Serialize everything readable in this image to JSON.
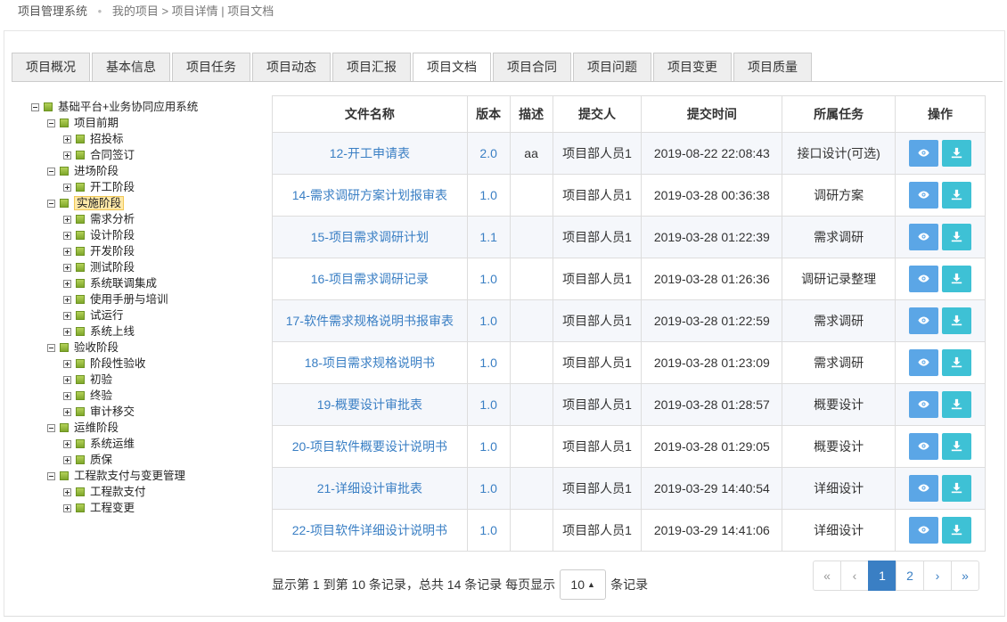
{
  "breadcrumb": {
    "system": "项目管理系统",
    "sep": "•",
    "path": "我的项目 > 项目详情 | 项目文档"
  },
  "tabs": [
    {
      "label": "项目概况",
      "active": false
    },
    {
      "label": "基本信息",
      "active": false
    },
    {
      "label": "项目任务",
      "active": false
    },
    {
      "label": "项目动态",
      "active": false
    },
    {
      "label": "项目汇报",
      "active": false
    },
    {
      "label": "项目文档",
      "active": true
    },
    {
      "label": "项目合同",
      "active": false
    },
    {
      "label": "项目问题",
      "active": false
    },
    {
      "label": "项目变更",
      "active": false
    },
    {
      "label": "项目质量",
      "active": false
    }
  ],
  "tree": [
    {
      "label": "基础平台+业务协同应用系统",
      "level": 0,
      "toggle": "minus"
    },
    {
      "label": "项目前期",
      "level": 1,
      "toggle": "minus"
    },
    {
      "label": "招投标",
      "level": 2,
      "toggle": "plus"
    },
    {
      "label": "合同签订",
      "level": 2,
      "toggle": "plus"
    },
    {
      "label": "进场阶段",
      "level": 1,
      "toggle": "minus"
    },
    {
      "label": "开工阶段",
      "level": 2,
      "toggle": "plus"
    },
    {
      "label": "实施阶段",
      "level": 1,
      "toggle": "minus",
      "selected": true
    },
    {
      "label": "需求分析",
      "level": 2,
      "toggle": "plus"
    },
    {
      "label": "设计阶段",
      "level": 2,
      "toggle": "plus"
    },
    {
      "label": "开发阶段",
      "level": 2,
      "toggle": "plus"
    },
    {
      "label": "测试阶段",
      "level": 2,
      "toggle": "plus"
    },
    {
      "label": "系统联调集成",
      "level": 2,
      "toggle": "plus"
    },
    {
      "label": "使用手册与培训",
      "level": 2,
      "toggle": "plus"
    },
    {
      "label": "试运行",
      "level": 2,
      "toggle": "plus"
    },
    {
      "label": "系统上线",
      "level": 2,
      "toggle": "plus"
    },
    {
      "label": "验收阶段",
      "level": 1,
      "toggle": "minus"
    },
    {
      "label": "阶段性验收",
      "level": 2,
      "toggle": "plus"
    },
    {
      "label": "初验",
      "level": 2,
      "toggle": "plus"
    },
    {
      "label": "终验",
      "level": 2,
      "toggle": "plus"
    },
    {
      "label": "审计移交",
      "level": 2,
      "toggle": "plus"
    },
    {
      "label": "运维阶段",
      "level": 1,
      "toggle": "minus"
    },
    {
      "label": "系统运维",
      "level": 2,
      "toggle": "plus"
    },
    {
      "label": "质保",
      "level": 2,
      "toggle": "plus"
    },
    {
      "label": "工程款支付与变更管理",
      "level": 1,
      "toggle": "minus"
    },
    {
      "label": "工程款支付",
      "level": 2,
      "toggle": "plus"
    },
    {
      "label": "工程变更",
      "level": 2,
      "toggle": "plus"
    }
  ],
  "table": {
    "headers": [
      "文件名称",
      "版本",
      "描述",
      "提交人",
      "提交时间",
      "所属任务",
      "操作"
    ],
    "rows": [
      {
        "name": "12-开工申请表",
        "version": "2.0",
        "desc": "aa",
        "submitter": "项目部人员1",
        "time": "2019-08-22 22:08:43",
        "task": "接口设计(可选)"
      },
      {
        "name": "14-需求调研方案计划报审表",
        "version": "1.0",
        "desc": "",
        "submitter": "项目部人员1",
        "time": "2019-03-28 00:36:38",
        "task": "调研方案"
      },
      {
        "name": "15-项目需求调研计划",
        "version": "1.1",
        "desc": "",
        "submitter": "项目部人员1",
        "time": "2019-03-28 01:22:39",
        "task": "需求调研"
      },
      {
        "name": "16-项目需求调研记录",
        "version": "1.0",
        "desc": "",
        "submitter": "项目部人员1",
        "time": "2019-03-28 01:26:36",
        "task": "调研记录整理"
      },
      {
        "name": "17-软件需求规格说明书报审表",
        "version": "1.0",
        "desc": "",
        "submitter": "项目部人员1",
        "time": "2019-03-28 01:22:59",
        "task": "需求调研"
      },
      {
        "name": "18-项目需求规格说明书",
        "version": "1.0",
        "desc": "",
        "submitter": "项目部人员1",
        "time": "2019-03-28 01:23:09",
        "task": "需求调研"
      },
      {
        "name": "19-概要设计审批表",
        "version": "1.0",
        "desc": "",
        "submitter": "项目部人员1",
        "time": "2019-03-28 01:28:57",
        "task": "概要设计"
      },
      {
        "name": "20-项目软件概要设计说明书",
        "version": "1.0",
        "desc": "",
        "submitter": "项目部人员1",
        "time": "2019-03-28 01:29:05",
        "task": "概要设计"
      },
      {
        "name": "21-详细设计审批表",
        "version": "1.0",
        "desc": "",
        "submitter": "项目部人员1",
        "time": "2019-03-29 14:40:54",
        "task": "详细设计"
      },
      {
        "name": "22-项目软件详细设计说明书",
        "version": "1.0",
        "desc": "",
        "submitter": "项目部人员1",
        "time": "2019-03-29 14:41:06",
        "task": "详细设计"
      }
    ],
    "actions": {
      "view_icon": "eye-icon",
      "download_icon": "download-icon",
      "view_color": "#5ba6e6",
      "download_color": "#3ec1d5"
    }
  },
  "footer": {
    "info_prefix": "显示第 1 到第 10 条记录，总共 14 条记录 每页显示",
    "page_size": "10",
    "caret": "▲",
    "info_suffix": "条记录"
  },
  "pager": {
    "first": "«",
    "prev": "‹",
    "pages": [
      "1",
      "2"
    ],
    "current": "1",
    "next": "›",
    "last": "»"
  }
}
